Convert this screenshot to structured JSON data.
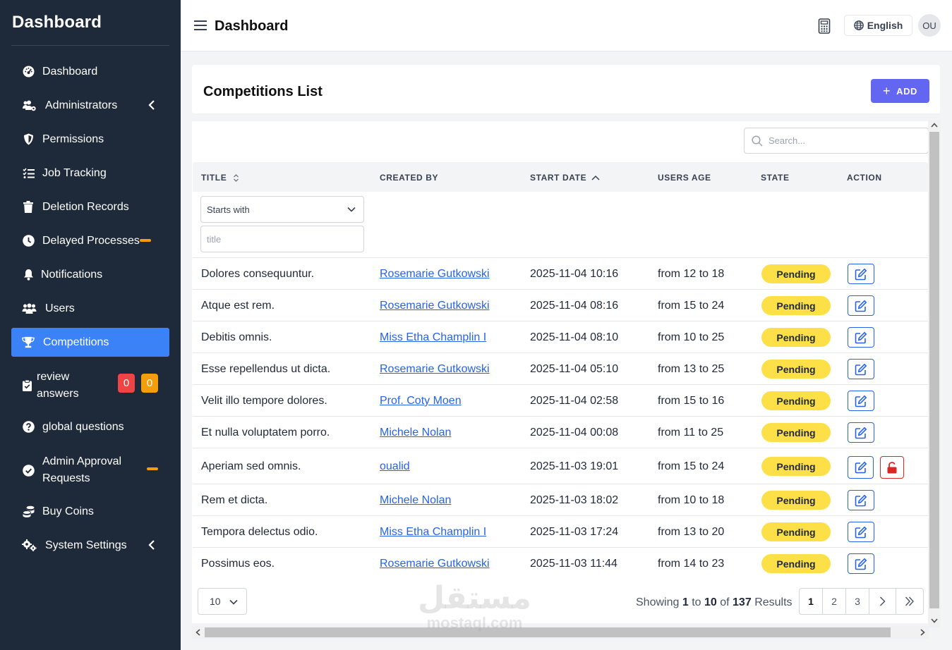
{
  "sidebar": {
    "brand": "Dashboard",
    "items": [
      {
        "label": "Dashboard"
      },
      {
        "label": "Administrators"
      },
      {
        "label": "Permissions"
      },
      {
        "label": "Job Tracking"
      },
      {
        "label": "Deletion Records"
      },
      {
        "label": "Delayed Processes"
      },
      {
        "label": "Notifications"
      },
      {
        "label": "Users"
      },
      {
        "label": "Competitions"
      },
      {
        "label_line1": "review",
        "label_line2": "answers",
        "badge_red": "0",
        "badge_orange": "0"
      },
      {
        "label": "global questions"
      },
      {
        "label_line1": "Admin Approval",
        "label_line2": "Requests"
      },
      {
        "label": "Buy Coins"
      },
      {
        "label": "System Settings"
      }
    ]
  },
  "header": {
    "title": "Dashboard",
    "language": "English",
    "avatar_initials": "OU"
  },
  "page": {
    "title": "Competitions List",
    "add_label": "ADD"
  },
  "table": {
    "search_placeholder": "Search...",
    "columns": [
      "TITLE",
      "CREATED BY",
      "START DATE",
      "USERS AGE",
      "STATE",
      "ACTION"
    ],
    "filter_mode": "Starts with",
    "filter_placeholder": "title",
    "rows": [
      {
        "title": "Dolores consequuntur.",
        "created_by": "Rosemarie Gutkowski",
        "start_date": "2025-11-04 10:16",
        "users_age": "from 12 to 18",
        "state": "Pending"
      },
      {
        "title": "Atque est rem.",
        "created_by": "Rosemarie Gutkowski",
        "start_date": "2025-11-04 08:16",
        "users_age": "from 15 to 24",
        "state": "Pending"
      },
      {
        "title": "Debitis omnis.",
        "created_by": "Miss Etha Champlin I",
        "start_date": "2025-11-04 08:10",
        "users_age": "from 10 to 25",
        "state": "Pending"
      },
      {
        "title": "Esse repellendus ut dicta.",
        "created_by": "Rosemarie Gutkowski",
        "start_date": "2025-11-04 05:10",
        "users_age": "from 13 to 25",
        "state": "Pending"
      },
      {
        "title": "Velit illo tempore dolores.",
        "created_by": "Prof. Coty Moen",
        "start_date": "2025-11-04 02:58",
        "users_age": "from 15 to 16",
        "state": "Pending"
      },
      {
        "title": "Et nulla voluptatem porro.",
        "created_by": "Michele Nolan",
        "start_date": "2025-11-04 00:08",
        "users_age": "from 11 to 25",
        "state": "Pending"
      },
      {
        "title": "Aperiam sed omnis.",
        "created_by": "oualid",
        "start_date": "2025-11-03 19:01",
        "users_age": "from 15 to 24",
        "state": "Pending",
        "locked": true
      },
      {
        "title": "Rem et dicta.",
        "created_by": "Michele Nolan",
        "start_date": "2025-11-03 18:02",
        "users_age": "from 10 to 18",
        "state": "Pending"
      },
      {
        "title": "Tempora delectus odio.",
        "created_by": "Miss Etha Champlin I",
        "start_date": "2025-11-03 17:24",
        "users_age": "from 13 to 20",
        "state": "Pending"
      },
      {
        "title": "Possimus eos.",
        "created_by": "Rosemarie Gutkowski",
        "start_date": "2025-11-03 11:44",
        "users_age": "from 14 to 23",
        "state": "Pending"
      }
    ]
  },
  "footer": {
    "per_page": "10",
    "showing_prefix": "Showing",
    "from": "1",
    "to_word": "to",
    "to": "10",
    "of_word": "of",
    "total": "137",
    "results_word": "Results",
    "pages": [
      "1",
      "2",
      "3"
    ]
  },
  "watermark": {
    "arabic": "مستقل",
    "latin": "mostaql.com"
  },
  "colors": {
    "sidebar_bg": "#1e2939",
    "active": "#3b82f6",
    "add_button": "#6366f1",
    "pending": "#fde047",
    "link": "#2563eb"
  }
}
